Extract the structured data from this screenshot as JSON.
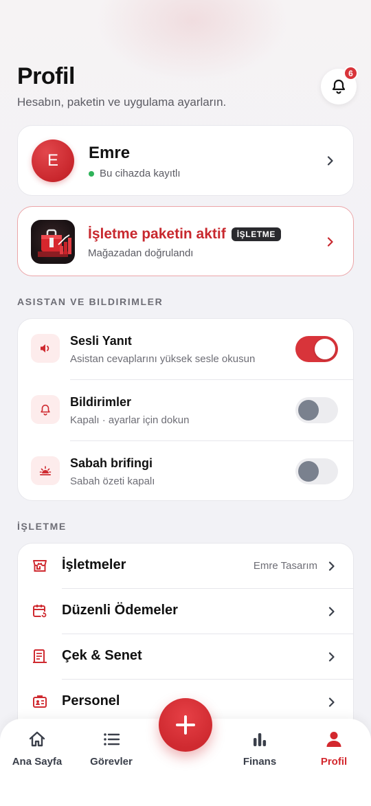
{
  "header": {
    "title": "Profil",
    "subtitle": "Hesabın, paketin ve uygulama ayarların.",
    "notification_count": "6"
  },
  "profile": {
    "avatar_letter": "E",
    "name": "Emre",
    "status": "Bu cihazda kayıtlı"
  },
  "package": {
    "title": "İşletme paketin aktif",
    "tag": "İŞLETME",
    "subtitle": "Mağazadan doğrulandı"
  },
  "sections": {
    "assistant": "ASISTAN VE BILDIRIMLER",
    "business": "İŞLETME"
  },
  "settings": [
    {
      "title": "Sesli Yanıt",
      "subtitle": "Asistan cevaplarını yüksek sesle okusun",
      "icon": "speaker-icon",
      "enabled": true
    },
    {
      "title": "Bildirimler",
      "subtitle": "Kapalı · ayarlar için dokun",
      "icon": "bell-icon",
      "enabled": false
    },
    {
      "title": "Sabah brifingi",
      "subtitle": "Sabah özeti kapalı",
      "icon": "sunrise-icon",
      "enabled": false
    }
  ],
  "business_items": [
    {
      "label": "İşletmeler",
      "value": "Emre Tasarım",
      "icon": "store-icon"
    },
    {
      "label": "Düzenli Ödemeler",
      "value": "",
      "icon": "calendar-repeat-icon"
    },
    {
      "label": "Çek & Senet",
      "value": "",
      "icon": "receipt-icon"
    },
    {
      "label": "Personel",
      "value": "",
      "icon": "id-badge-icon"
    }
  ],
  "tabbar": {
    "home": "Ana Sayfa",
    "tasks": "Görevler",
    "finance": "Finans",
    "profile": "Profil",
    "active": "profile"
  },
  "colors": {
    "accent": "#d3282e",
    "toggle_off_knob": "#7a818e",
    "status_green": "#2fb35a"
  }
}
